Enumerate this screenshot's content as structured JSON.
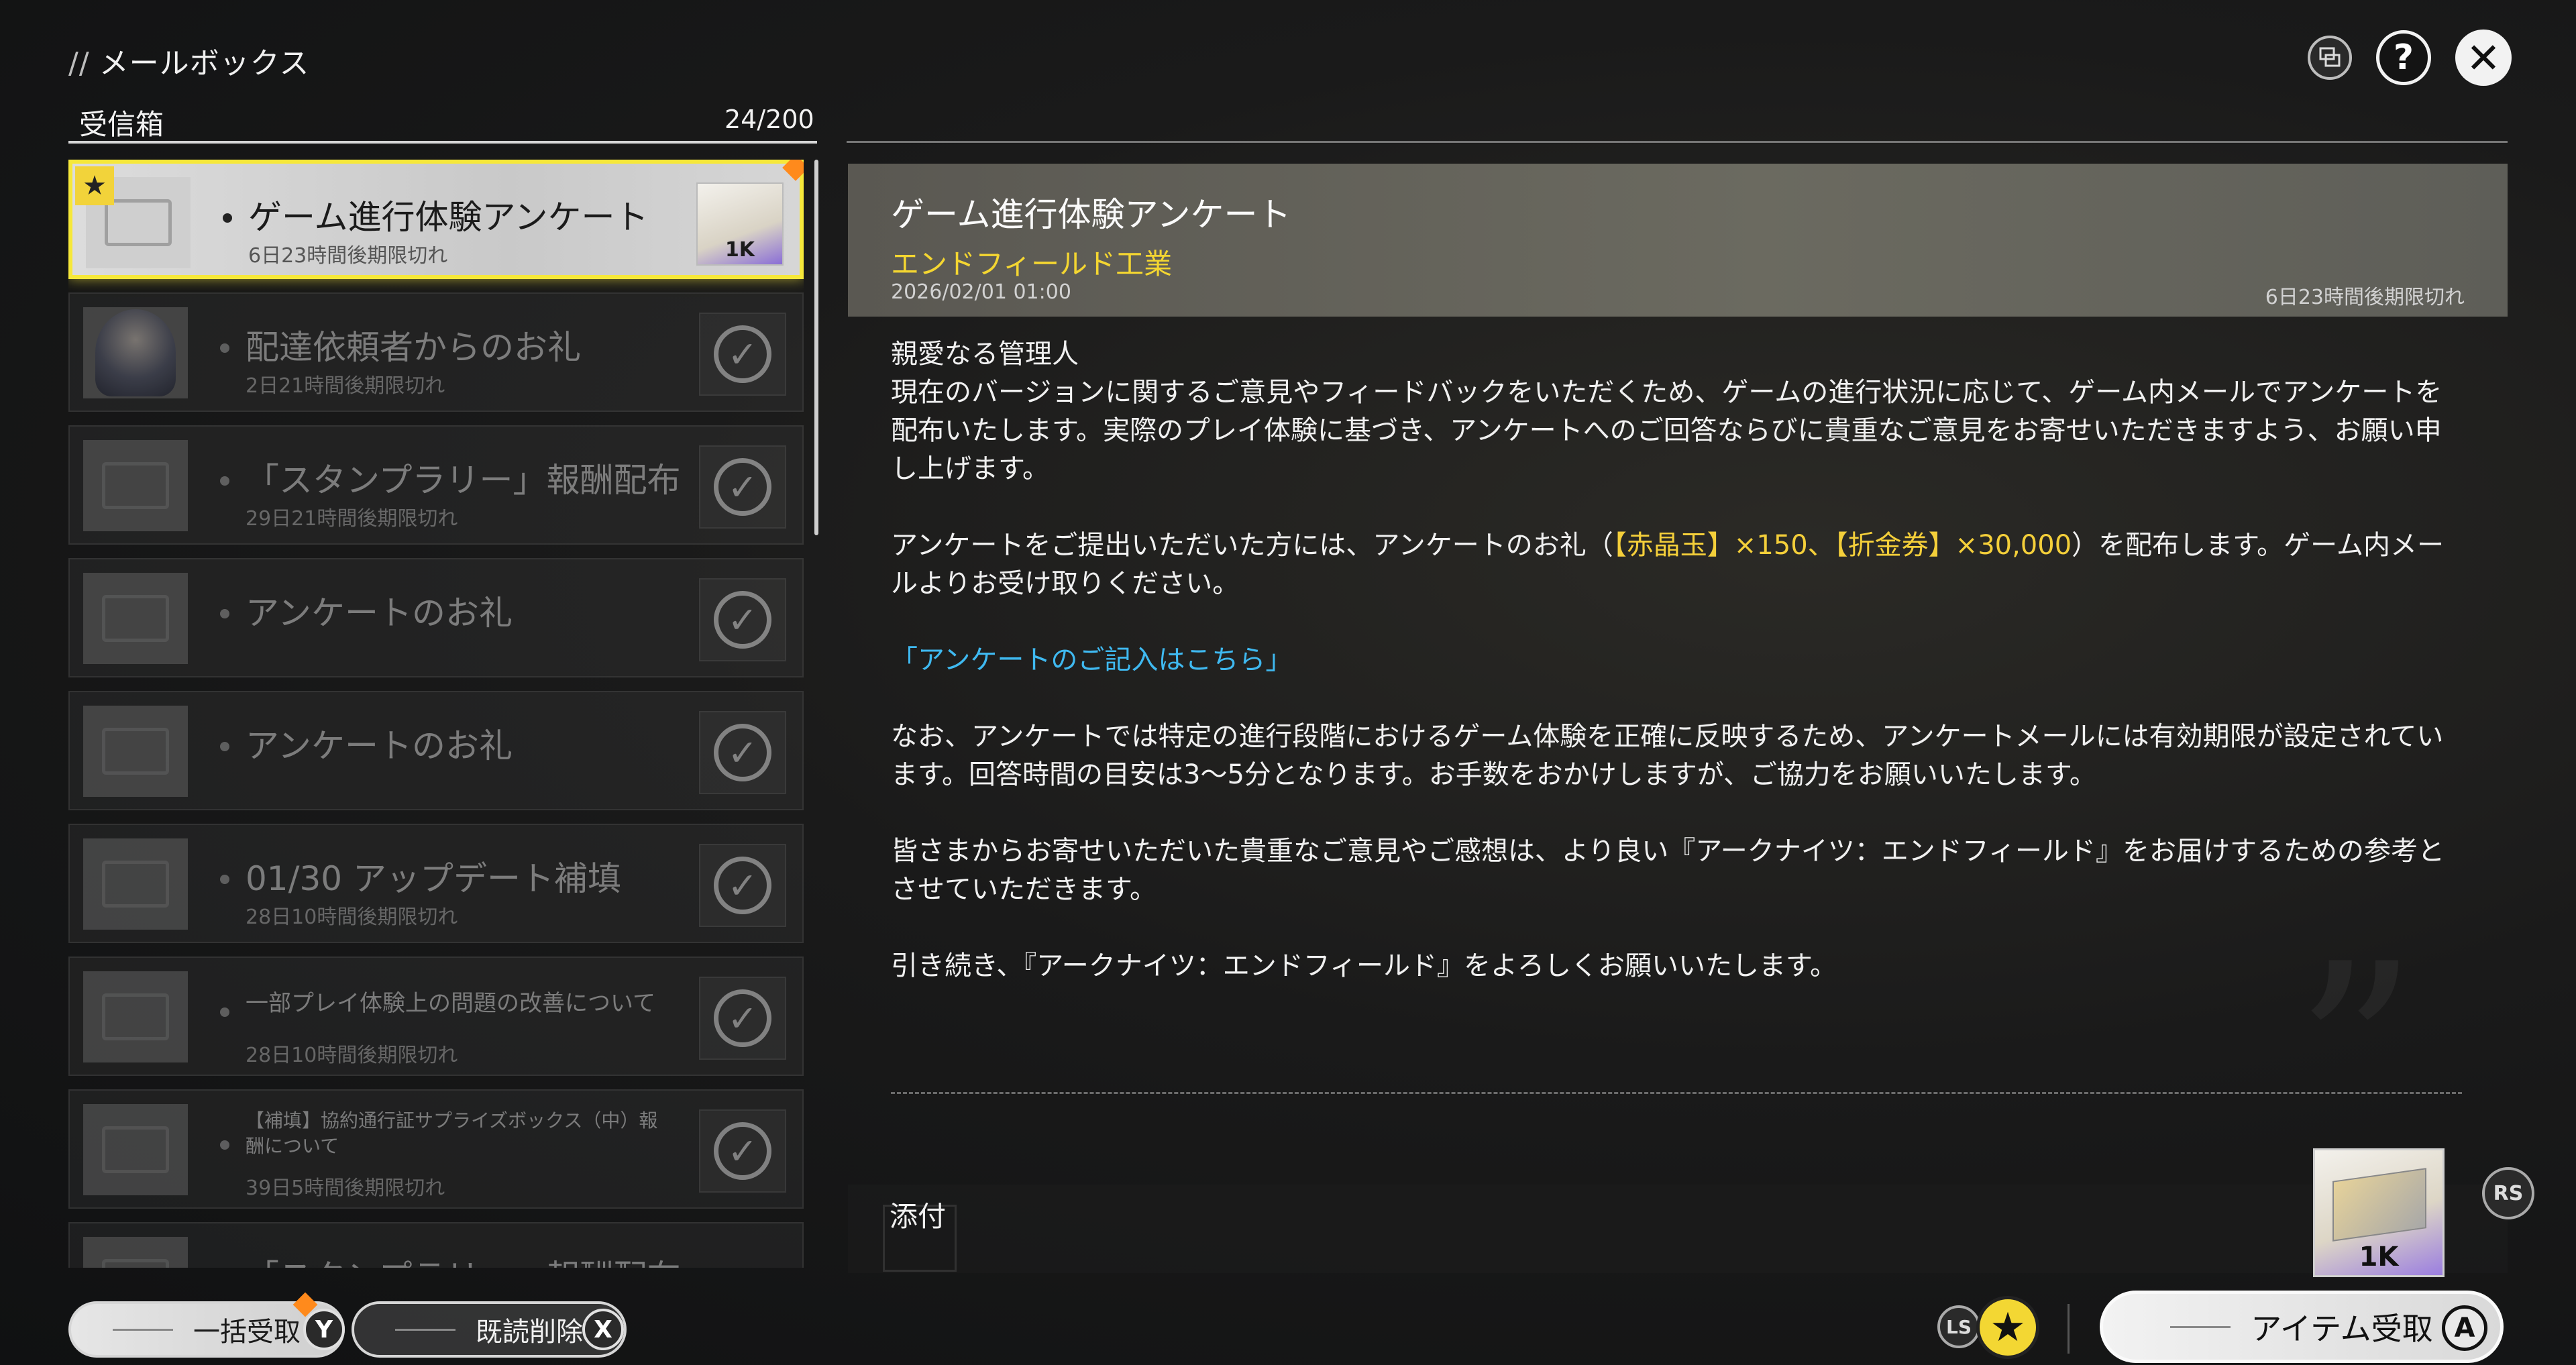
{
  "header": {
    "slashes": "//",
    "title": "メールボックス"
  },
  "top_icons": {
    "window_icon": "window-icon",
    "help_symbol": "?",
    "close_symbol": "✕"
  },
  "inbox": {
    "label": "受信箱",
    "count": "24/200"
  },
  "mails": [
    {
      "title": "ゲーム進行体験アンケート",
      "expire": "6日23時間後期限切れ",
      "reward_qty": "1K",
      "selected": true
    },
    {
      "title": "配達依頼者からのお礼",
      "expire": "2日21時間後期限切れ"
    },
    {
      "title": "「スタンプラリー」報酬配布",
      "expire": "29日21時間後期限切れ"
    },
    {
      "title": "アンケートのお礼",
      "expire": ""
    },
    {
      "title": "アンケートのお礼",
      "expire": ""
    },
    {
      "title": "01/30 アップデート補填",
      "expire": "28日10時間後期限切れ"
    },
    {
      "title": "一部プレイ体験上の問題の改善について",
      "expire": "28日10時間後期限切れ"
    },
    {
      "title": "【補填】協約通行証サプライズボックス（中）報酬について",
      "expire": "39日5時間後期限切れ"
    },
    {
      "title": "「スタンプラリー」報酬配布",
      "expire": ""
    }
  ],
  "detail": {
    "title": "ゲーム進行体験アンケート",
    "sender": "エンドフィールド工業",
    "date": "2026/02/01 01:00",
    "expire": "6日23時間後期限切れ",
    "greeting": "親愛なる管理人",
    "para1": "現在のバージョンに関するご意見やフィードバックをいただくため、ゲームの進行状況に応じて、ゲーム内メールでアンケートを配布いたします。実際のプレイ体験に基づき、アンケートへのご回答ならびに貴重なご意見をお寄せいただきますよう、お願い申し上げます。",
    "para2_a": "アンケートをご提出いただいた方には、アンケートのお礼（",
    "para2_hl": "【赤晶玉】×150、【折金券】×30,000",
    "para2_b": "）を配布します。ゲーム内メールよりお受け取りください。",
    "link": "「アンケートのご記入はこちら」",
    "para3": "なお、アンケートでは特定の進行段階におけるゲーム体験を正確に反映するため、アンケートメールには有効期限が設定されています。回答時間の目安は3〜5分となります。お手数をおかけしますが、ご協力をお願いいたします。",
    "para4": "皆さまからお寄せいただいた貴重なご意見やご感想は、より良い『アークナイツ：エンドフィールド』をお届けするための参考とさせていただきます。",
    "para5": "引き続き、『アークナイツ：エンドフィールド』をよろしくお願いいたします。"
  },
  "attachment": {
    "label": "添付",
    "qty": "1K",
    "rs": "RS"
  },
  "bottom": {
    "bulk_label": "一括受取",
    "bulk_key": "Y",
    "delete_label": "既読削除",
    "delete_key": "X",
    "ls": "LS",
    "star": "★",
    "receive_label": "アイテム受取",
    "receive_key": "A"
  },
  "colors": {
    "accent_yellow": "#f4d631",
    "link_blue": "#3fb9f0",
    "selected_border": "#f6e83a",
    "new_dot": "#ff8a1c"
  }
}
